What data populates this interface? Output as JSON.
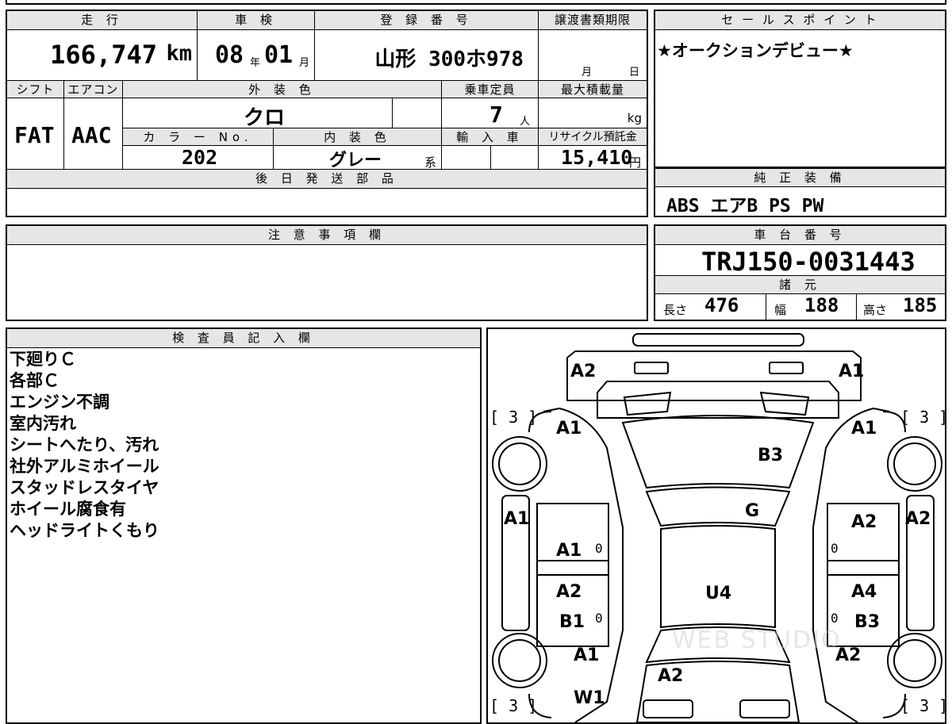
{
  "headers": {
    "mileage": "走 行",
    "inspection": "車 検",
    "registration": "登 録 番 号",
    "transfer_deadline": "譲渡書類期限",
    "sales_point": "セ ー ル ス ポ イ ン ト",
    "shift": "シフト",
    "aircon": "エアコン",
    "exterior_color": "外 装 色",
    "capacity": "乗車定員",
    "max_load": "最大積載量",
    "color_no": "カ ラ ー No.",
    "interior_color": "内 装 色",
    "import": "輸 入 車",
    "recycle": "リサイクル預託金",
    "later_parts": "後 日 発 送 部 品",
    "genuine_equipment": "純 正 装 備",
    "notes": "注 意 事 項 欄",
    "chassis": "車 台 番 号",
    "specs": "諸 元",
    "inspector": "検 査 員 記 入 欄"
  },
  "values": {
    "mileage": "166,747",
    "mileage_unit": "km",
    "inspection_year": "08",
    "inspection_year_unit": "年",
    "inspection_month": "01",
    "inspection_month_unit": "月",
    "registration": "山形 300ホ978",
    "deadline_month_unit": "月",
    "deadline_day_unit": "日",
    "sales_point": "★オークションデビュー★",
    "shift": "FAT",
    "aircon": "AAC",
    "exterior_color": "クロ",
    "capacity": "7",
    "capacity_unit": "人",
    "max_load_unit": "kg",
    "color_no": "202",
    "interior_color": "グレー",
    "interior_suffix": "系",
    "recycle": "15,410",
    "recycle_unit": "円",
    "genuine_equipment": "ABS エアB PS PW",
    "chassis": "TRJ150-0031443",
    "length_label": "長さ",
    "length": "476",
    "width_label": "幅",
    "width": "188",
    "height_label": "高さ",
    "height": "185"
  },
  "inspector_notes": [
    "下廻りＣ",
    "各部Ｃ",
    "エンジン不調",
    "室内汚れ",
    "シートへたり、汚れ",
    "社外アルミホイール",
    "スタッドレスタイヤ",
    "ホイール腐食有",
    "ヘッドライトくもり"
  ],
  "diagram": {
    "marks": {
      "front_left": "A2",
      "front_right": "A1",
      "fender_left": "A1",
      "fender_right": "A1",
      "hood": "B3",
      "windshield": "G",
      "pillar_left": "A1",
      "pillar_right": "A2",
      "door_fl": "A1",
      "door_fr": "A2",
      "door_rl_1": "A2",
      "door_rl_2": "B1",
      "door_rr_1": "A4",
      "door_rr_2": "B3",
      "roof": "U4",
      "rear_fender_left": "A1",
      "rear_fender_right": "A2",
      "rear_left_wheel": "W1",
      "rear_center": "A2"
    },
    "tire_front_left": "[ 3 ]",
    "tire_front_right": "[ 3 ]",
    "tire_rear_left": "[ 3 ]",
    "tire_rear_right": "[ 3 ]",
    "zero": "0",
    "watermark": "WEB STUDIO"
  }
}
